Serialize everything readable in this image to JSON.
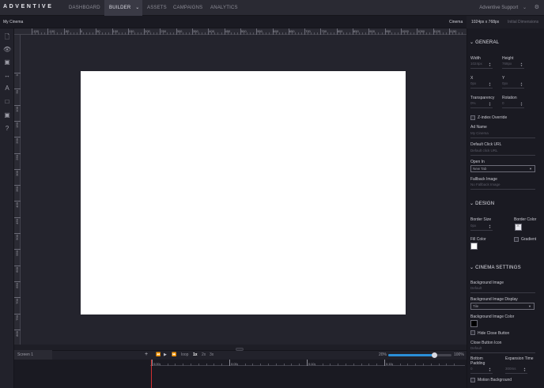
{
  "app": {
    "logo": "ADVENTIVE",
    "user": "Adventive Support"
  },
  "nav": {
    "dashboard": "DASHBOARD",
    "builder": "BUILDER",
    "assets": "ASSETS",
    "campaigns": "CAMPAIGNS",
    "analytics": "ANALYTICS"
  },
  "subbar": {
    "project": "My Cinema",
    "cinema": "Cinema",
    "dimensions": "1024px x 768px",
    "initial": "Initial Dimensions"
  },
  "ruler": {
    "h_ticks": [
      "-150",
      "-100",
      "-50",
      "0",
      "50",
      "100",
      "150",
      "200",
      "250",
      "300",
      "350",
      "400",
      "450",
      "500",
      "550",
      "600",
      "650",
      "700",
      "750",
      "800",
      "850",
      "900",
      "950",
      "1000",
      "1050",
      "1100",
      "1150"
    ],
    "v_ticks": [
      "0",
      "50",
      "100",
      "150",
      "200",
      "250",
      "300",
      "350",
      "400",
      "450",
      "500",
      "550",
      "600",
      "650",
      "700",
      "750",
      "800",
      "850",
      "900"
    ]
  },
  "timeline": {
    "screen": "Screen 1",
    "loop": "loop",
    "speeds": [
      "1x",
      "2x",
      "3x"
    ],
    "zoom_min": "20%",
    "zoom_max": "100%",
    "zoom_value": 0.72,
    "marks": [
      "0:00",
      "0:05",
      "0:10",
      "0:15"
    ]
  },
  "panel": {
    "general": {
      "title": "GENERAL",
      "width_label": "Width",
      "width_val": "1024px",
      "height_label": "Height",
      "height_val": "768px",
      "x_label": "X",
      "x_val": "0px",
      "y_label": "Y",
      "y_val": "0px",
      "trans_label": "Transparency",
      "trans_val": "0%",
      "rot_label": "Rotation",
      "rot_val": "0",
      "zindex": "Z-index Override",
      "adname_label": "Ad Name",
      "adname_val": "My Cinema",
      "click_label": "Default Click URL",
      "click_ph": "Default click URL",
      "open_label": "Open In",
      "open_val": "New Tab",
      "fallback_label": "Fallback Image",
      "fallback_val": "No Fallback Image"
    },
    "design": {
      "title": "DESIGN",
      "bsize_label": "Border Size",
      "bsize_val": "0px",
      "bcolor_label": "Border Color",
      "fill_label": "Fill Color",
      "gradient": "Gradient"
    },
    "cinema": {
      "title": "CINEMA SETTINGS",
      "bg_label": "Background Image",
      "bg_val": "Default",
      "bgdisp_label": "Background Image Display",
      "bgdisp_val": "Tile",
      "bgcolor_label": "Background Image Color",
      "hideclose": "Hide Close Button",
      "closeicon_label": "Close Button Icon",
      "closeicon_val": "Default",
      "bpad_label": "Bottom Padding",
      "bpad_val": "0",
      "exp_label": "Expansion Time",
      "exp_val": "300ms",
      "motion": "Motion Background"
    }
  },
  "colors": {
    "accent": "#2a8fd8",
    "playhead": "#d03030",
    "artboard": "#ffffff"
  }
}
